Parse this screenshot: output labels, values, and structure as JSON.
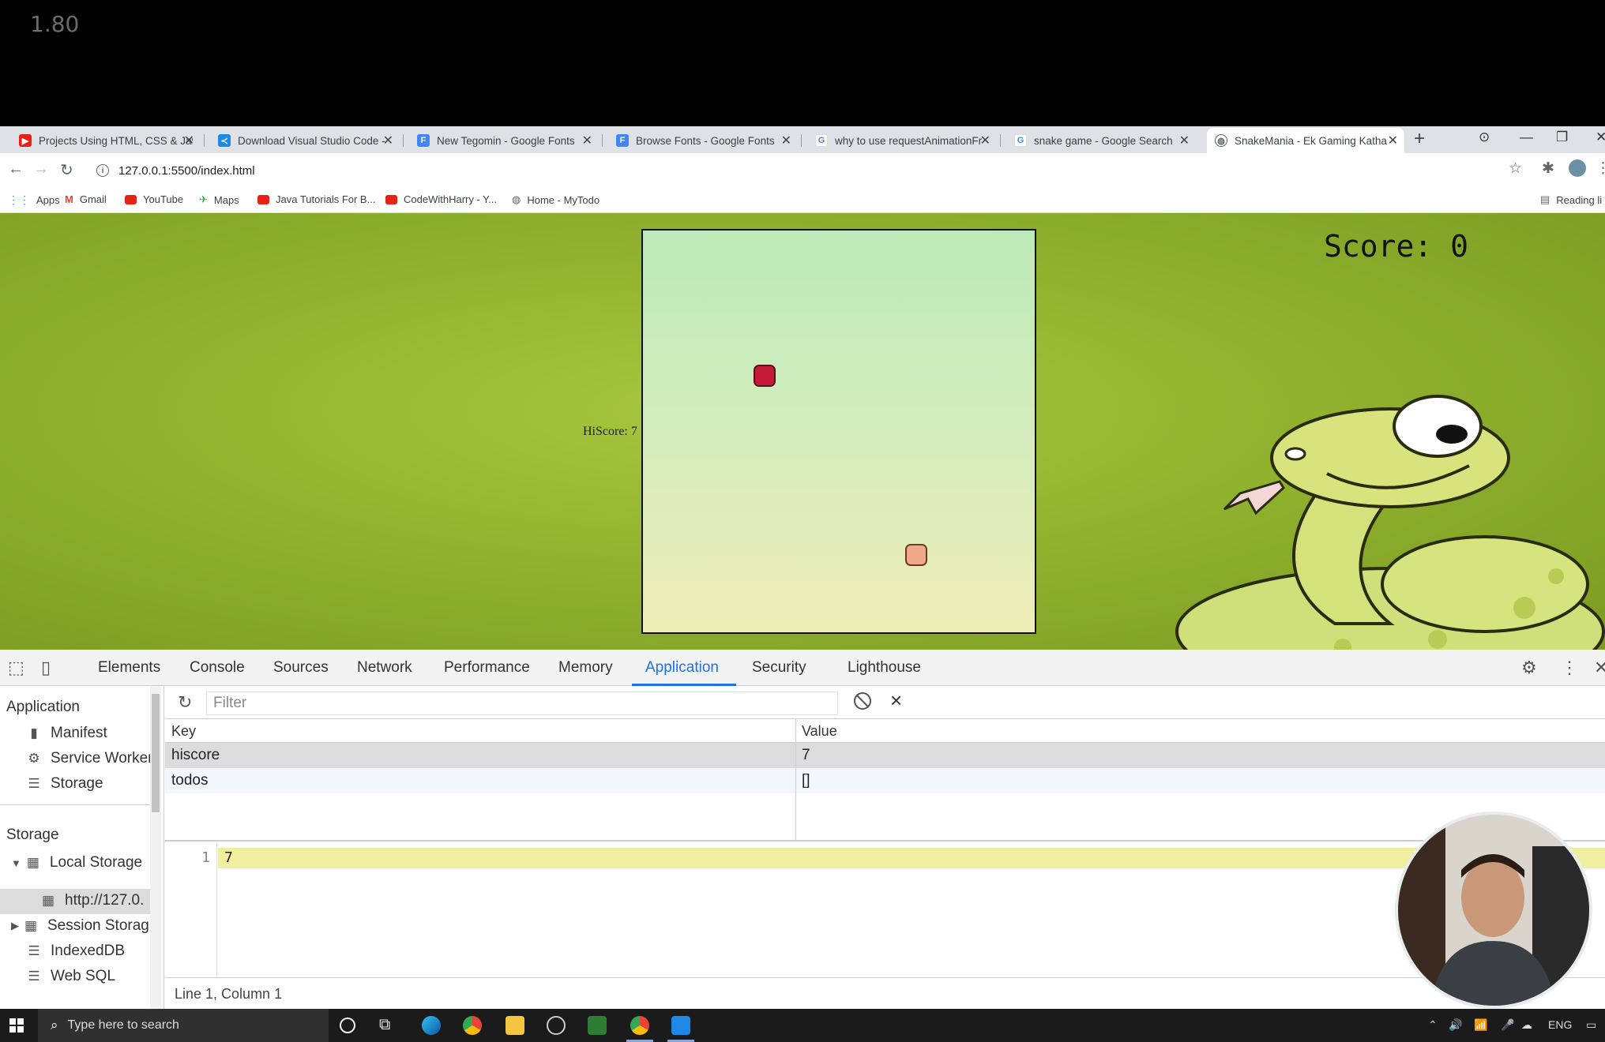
{
  "video": {
    "speed": "1.80"
  },
  "browser": {
    "tabs": [
      {
        "label": "Projects Using HTML, CSS & Jav",
        "fav": "youtube",
        "color": "#e62117"
      },
      {
        "label": "Download Visual Studio Code -",
        "fav": "vscode",
        "color": "#1e88e5"
      },
      {
        "label": "New Tegomin - Google Fonts",
        "fav": "google-fonts",
        "color": "#4285f4"
      },
      {
        "label": "Browse Fonts - Google Fonts",
        "fav": "google-fonts",
        "color": "#4285f4"
      },
      {
        "label": "why to use requestAnimationFr",
        "fav": "google",
        "color": "#4285f4"
      },
      {
        "label": "snake game - Google Search",
        "fav": "google",
        "color": "#4285f4"
      },
      {
        "label": "SnakeMania - Ek Gaming Katha",
        "fav": "globe",
        "color": "#5f6368",
        "active": true
      }
    ],
    "url": "127.0.0.1:5500/index.html",
    "bookmarks": [
      {
        "label": "Apps",
        "color": "#4285f4"
      },
      {
        "label": "Gmail",
        "color": "#ea4335"
      },
      {
        "label": "YouTube",
        "color": "#e62117"
      },
      {
        "label": "Maps",
        "color": "#34a853"
      },
      {
        "label": "Java Tutorials For B...",
        "color": "#e62117"
      },
      {
        "label": "CodeWithHarry - Y...",
        "color": "#e62117"
      },
      {
        "label": "Home - MyTodo",
        "color": "#5f6368"
      }
    ],
    "reading_list": "Reading li"
  },
  "game": {
    "hiscore": "HiScore: 7",
    "score": "Score: 0"
  },
  "devtools": {
    "tabs": [
      "Elements",
      "Console",
      "Sources",
      "Network",
      "Performance",
      "Memory",
      "Application",
      "Security",
      "Lighthouse"
    ],
    "active_tab": "Application",
    "sidebar": {
      "application_header": "Application",
      "application_items": [
        "Manifest",
        "Service Worker",
        "Storage"
      ],
      "storage_header": "Storage",
      "storage_items": [
        "Local Storage",
        "http://127.0.",
        "Session Storag",
        "IndexedDB",
        "Web SQL"
      ]
    },
    "filter_placeholder": "Filter",
    "table": {
      "headers": [
        "Key",
        "Value"
      ],
      "rows": [
        {
          "key": "hiscore",
          "value": "7"
        },
        {
          "key": "todos",
          "value": "[]"
        }
      ]
    },
    "editor": {
      "line_number": "1",
      "content": "7"
    },
    "status": "Line 1, Column 1"
  },
  "taskbar": {
    "search_placeholder": "Type here to search",
    "lang": "ENG"
  }
}
